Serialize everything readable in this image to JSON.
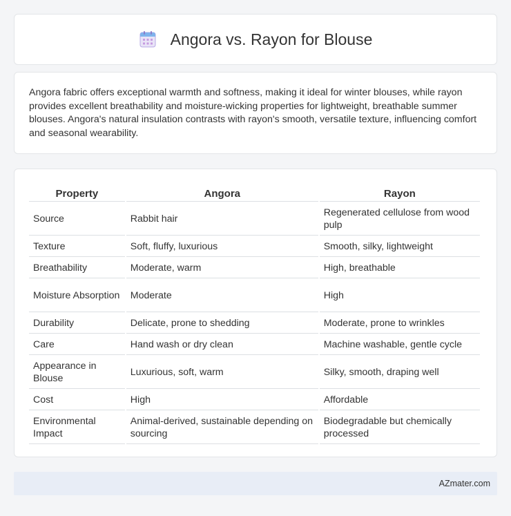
{
  "header": {
    "title": "Angora vs. Rayon for Blouse",
    "icon": "calendar-icon"
  },
  "intro": {
    "text": "Angora fabric offers exceptional warmth and softness, making it ideal for winter blouses, while rayon provides excellent breathability and moisture-wicking properties for lightweight, breathable summer blouses. Angora's natural insulation contrasts with rayon's smooth, versatile texture, influencing comfort and seasonal wearability."
  },
  "table": {
    "headers": [
      "Property",
      "Angora",
      "Rayon"
    ],
    "rows": [
      [
        "Source",
        "Rabbit hair",
        "Regenerated cellulose from wood pulp"
      ],
      [
        "Texture",
        "Soft, fluffy, luxurious",
        "Smooth, silky, lightweight"
      ],
      [
        "Breathability",
        "Moderate, warm",
        "High, breathable"
      ],
      [
        "Moisture Absorption",
        "Moderate",
        "High"
      ],
      [
        "Durability",
        "Delicate, prone to shedding",
        "Moderate, prone to wrinkles"
      ],
      [
        "Care",
        "Hand wash or dry clean",
        "Machine washable, gentle cycle"
      ],
      [
        "Appearance in Blouse",
        "Luxurious, soft, warm",
        "Silky, smooth, draping well"
      ],
      [
        "Cost",
        "High",
        "Affordable"
      ],
      [
        "Environmental Impact",
        "Animal-derived, sustainable depending on sourcing",
        "Biodegradable but chemically processed"
      ]
    ]
  },
  "footer": {
    "brand": "AZmater.com"
  }
}
